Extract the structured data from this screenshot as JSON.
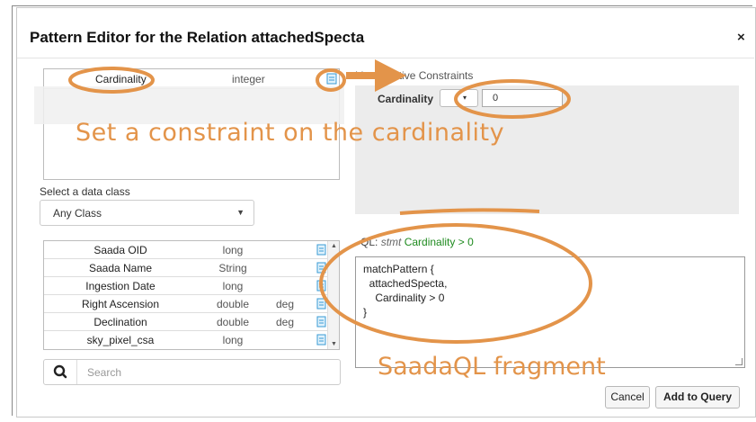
{
  "dialog": {
    "title": "Pattern Editor for the Relation attachedSpecta",
    "close_symbol": "×"
  },
  "attribute": {
    "name": "Cardinality",
    "type": "integer",
    "icon": "add-constraint-icon"
  },
  "class_selector": {
    "label": "Select a data class",
    "selected": "Any Class"
  },
  "fields": [
    {
      "name": "Saada OID",
      "type": "long",
      "unit": ""
    },
    {
      "name": "Saada Name",
      "type": "String",
      "unit": ""
    },
    {
      "name": "Ingestion Date",
      "type": "long",
      "unit": ""
    },
    {
      "name": "Right Ascension",
      "type": "double",
      "unit": "deg"
    },
    {
      "name": "Declination",
      "type": "double",
      "unit": "deg"
    },
    {
      "name": "sky_pixel_csa",
      "type": "long",
      "unit": ""
    }
  ],
  "search": {
    "placeholder": "Search",
    "icon": "search-icon"
  },
  "constraints": {
    "label": "List of Active Constraints",
    "item_label": "Cardinality",
    "operator_caret": "▾",
    "value": "0"
  },
  "ql": {
    "label_prefix": "QL",
    "label_stmt": "stmt",
    "label_expr": "Cardinality > 0",
    "lines": [
      "matchPattern {",
      "  attachedSpecta,",
      "    Cardinality > 0",
      "}"
    ]
  },
  "buttons": {
    "cancel": "Cancel",
    "add": "Add to Query"
  },
  "annotations": {
    "constraint_note": "Set a constraint on the cardinality",
    "ql_note": "SaadaQL fragment",
    "color": "#e3944a"
  }
}
